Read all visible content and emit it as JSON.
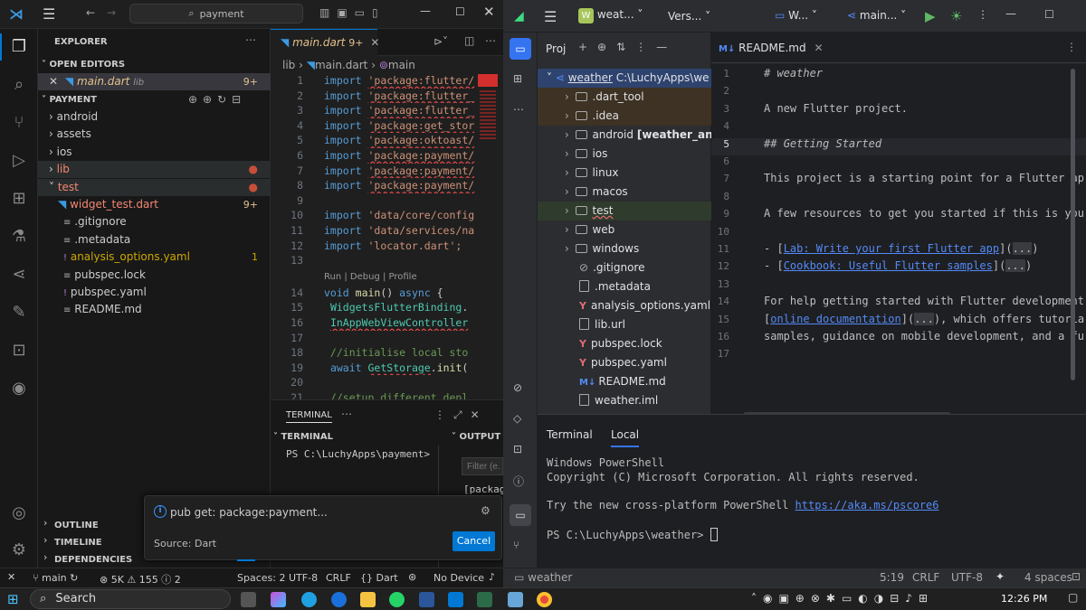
{
  "vscode": {
    "search": "payment",
    "explorer_title": "EXPLORER",
    "open_editors": "OPEN EDITORS",
    "open_file": {
      "name": "main.dart",
      "folder": "lib",
      "badge": "9+"
    },
    "workspace": "PAYMENT",
    "tree": [
      {
        "name": "android",
        "type": "folder"
      },
      {
        "name": "assets",
        "type": "folder"
      },
      {
        "name": "ios",
        "type": "folder"
      },
      {
        "name": "lib",
        "type": "folder"
      },
      {
        "name": "test",
        "type": "folder-open"
      },
      {
        "name": "widget_test.dart",
        "type": "file",
        "badge": "9+"
      },
      {
        "name": ".gitignore",
        "type": "file"
      },
      {
        "name": ".metadata",
        "type": "file"
      },
      {
        "name": "analysis_options.yaml",
        "type": "file",
        "badge": "1"
      },
      {
        "name": "pubspec.lock",
        "type": "file"
      },
      {
        "name": "pubspec.yaml",
        "type": "file"
      },
      {
        "name": "README.md",
        "type": "file"
      }
    ],
    "sections": [
      "OUTLINE",
      "TIMELINE",
      "DEPENDENCIES"
    ],
    "tab": {
      "name": "main.dart",
      "badge": "9+"
    },
    "breadcrumb": [
      "lib",
      "main.dart",
      "main"
    ],
    "codelens": "Run | Debug | Profile",
    "code": [
      {
        "n": "1",
        "a": "import ",
        "b": "'package:flutter/"
      },
      {
        "n": "2",
        "a": "import ",
        "b": "'package:flutter_"
      },
      {
        "n": "3",
        "a": "import ",
        "b": "'package:flutter_"
      },
      {
        "n": "4",
        "a": "import ",
        "b": "'package:get_stor"
      },
      {
        "n": "5",
        "a": "import ",
        "b": "'package:oktoast/"
      },
      {
        "n": "6",
        "a": "import ",
        "b": "'package:payment/"
      },
      {
        "n": "7",
        "a": "import ",
        "b": "'package:payment/"
      },
      {
        "n": "8",
        "a": "import ",
        "b": "'package:payment/"
      },
      {
        "n": "9",
        "a": "",
        "b": ""
      },
      {
        "n": "10",
        "a": "import ",
        "b": "'data/core/config"
      },
      {
        "n": "11",
        "a": "import ",
        "b": "'data/services/na"
      },
      {
        "n": "12",
        "a": "import ",
        "b": "'locator.dart';"
      },
      {
        "n": "13",
        "a": "",
        "b": ""
      }
    ],
    "code2": [
      {
        "n": "14",
        "t": "void main() async {"
      },
      {
        "n": "15",
        "t": "  WidgetsFlutterBinding."
      },
      {
        "n": "16",
        "t": "  InAppWebViewController"
      },
      {
        "n": "17",
        "t": ""
      },
      {
        "n": "18",
        "t": "  //initialise local sto"
      },
      {
        "n": "19",
        "t": "  await GetStorage.init("
      },
      {
        "n": "20",
        "t": ""
      },
      {
        "n": "21",
        "t": "  //setup different depl"
      }
    ],
    "panel_tab": "TERMINAL",
    "terminal_header": "TERMINAL",
    "output_header": "OUTPUT",
    "prompt": "PS C:\\LuchyApps\\payment>",
    "filter_placeholder": "Filter (e.",
    "output_text": "[packag",
    "notification": {
      "message": "pub get: package:payment...",
      "source": "Source: Dart",
      "button": "Cancel"
    },
    "status": {
      "branch": "main",
      "errors": "5K",
      "warnings": "155",
      "info": "2",
      "spaces": "Spaces: 2",
      "encoding": "UTF-8",
      "eol": "CRLF",
      "lang": "Dart",
      "device": "No Device"
    }
  },
  "studio": {
    "project_badge": "W",
    "project": "weat...",
    "vcs": "Vers...",
    "device": "W...",
    "config": "main...",
    "panel_title": "Proj",
    "root": {
      "name": "weather",
      "path": "C:\\LuchyApps\\we"
    },
    "tree": [
      {
        "name": ".dart_tool",
        "type": "folder"
      },
      {
        "name": ".idea",
        "type": "folder"
      },
      {
        "name": "android",
        "extra": "[weather_andro",
        "type": "folder"
      },
      {
        "name": "ios",
        "type": "folder"
      },
      {
        "name": "linux",
        "type": "folder"
      },
      {
        "name": "macos",
        "type": "folder"
      },
      {
        "name": "test",
        "type": "folder"
      },
      {
        "name": "web",
        "type": "folder"
      },
      {
        "name": "windows",
        "type": "folder"
      },
      {
        "name": ".gitignore",
        "type": "ignore"
      },
      {
        "name": ".metadata",
        "type": "text"
      },
      {
        "name": "analysis_options.yaml",
        "type": "yaml"
      },
      {
        "name": "lib.url",
        "type": "file"
      },
      {
        "name": "pubspec.lock",
        "type": "yaml"
      },
      {
        "name": "pubspec.yaml",
        "type": "yaml"
      },
      {
        "name": "README.md",
        "type": "md"
      },
      {
        "name": "weather.iml",
        "type": "file"
      }
    ],
    "editor_tab": "README.md",
    "readme": [
      {
        "n": "1",
        "t": "# weather",
        "k": "h"
      },
      {
        "n": "2",
        "t": "",
        "k": ""
      },
      {
        "n": "3",
        "t": "A new Flutter project.",
        "k": ""
      },
      {
        "n": "4",
        "t": "",
        "k": ""
      },
      {
        "n": "5",
        "t": "## Getting Started",
        "k": "h"
      },
      {
        "n": "6",
        "t": "",
        "k": ""
      },
      {
        "n": "7",
        "t": "This project is a starting point for a Flutter ap",
        "k": ""
      },
      {
        "n": "8",
        "t": "",
        "k": ""
      },
      {
        "n": "9",
        "t": "A few resources to get you started if this is you",
        "k": ""
      },
      {
        "n": "10",
        "t": "",
        "k": ""
      },
      {
        "n": "11",
        "t": "- [Lab: Write your first Flutter app](...)",
        "k": "l"
      },
      {
        "n": "12",
        "t": "- [Cookbook: Useful Flutter samples](...)",
        "k": "l"
      },
      {
        "n": "13",
        "t": "",
        "k": ""
      },
      {
        "n": "14",
        "t": "For help getting started with Flutter development",
        "k": ""
      },
      {
        "n": "15",
        "t": "[online documentation](...), which offers tutoria",
        "k": "l"
      },
      {
        "n": "16",
        "t": "samples, guidance on mobile development, and a fu",
        "k": ""
      },
      {
        "n": "17",
        "t": "",
        "k": ""
      }
    ],
    "terminal_tabs": [
      "Terminal",
      "Local"
    ],
    "terminal_lines": [
      "Windows PowerShell",
      "Copyright (C) Microsoft Corporation. All rights reserved.",
      "",
      "Try the new cross-platform PowerShell https://aka.ms/pscore6",
      "",
      "PS C:\\LuchyApps\\weather>"
    ],
    "status": {
      "project": "weather",
      "pos": "5:19",
      "eol": "CRLF",
      "encoding": "UTF-8",
      "indent": "4 spaces"
    }
  },
  "taskbar": {
    "search": "Search",
    "time": "12:26 PM"
  }
}
